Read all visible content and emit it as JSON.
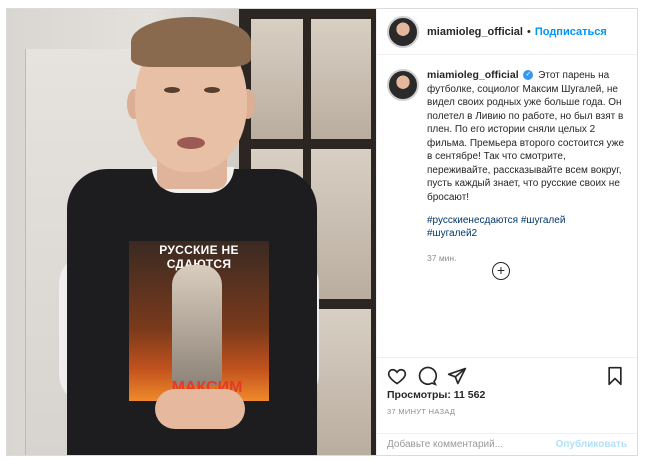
{
  "post": {
    "media": {
      "shirt_print_title": "РУССКИЕ НЕ СДАЮТСЯ",
      "shirt_print_bottom": "МАКСИМ"
    },
    "header": {
      "username": "miamioleg_official",
      "separator": "•",
      "follow_label": "Подписаться"
    },
    "caption": {
      "username": "miamioleg_official",
      "text": "Этот парень на футболке, социолог Максим Шугалей, не видел своих родных уже больше года. Он полетел в Ливию по работе, но был взят в плен. По его истории сняли целых 2 фильма. Премьера второго состоится уже в сентябре! Так что смотрите, переживайте, рассказывайте всем вокруг, пусть каждый знает, что русские своих не бросают!",
      "hashtags": [
        "#русскиенесдаются",
        "#шугалей",
        "#шугалей2"
      ],
      "time": "37 мин."
    },
    "actions": {
      "icons": [
        "heart-icon",
        "comment-icon",
        "share-icon",
        "bookmark-icon"
      ]
    },
    "stats": {
      "views": "Просмотры: 11 562",
      "posted_ago": "37 МИНУТ НАЗАД"
    },
    "comment_box": {
      "placeholder": "Добавьте комментарий...",
      "publish_label": "Опубликовать"
    },
    "colors": {
      "link": "#0095f6",
      "hashtag": "#00376b",
      "muted": "#8e8e8e",
      "verified": "#3897f0"
    }
  }
}
